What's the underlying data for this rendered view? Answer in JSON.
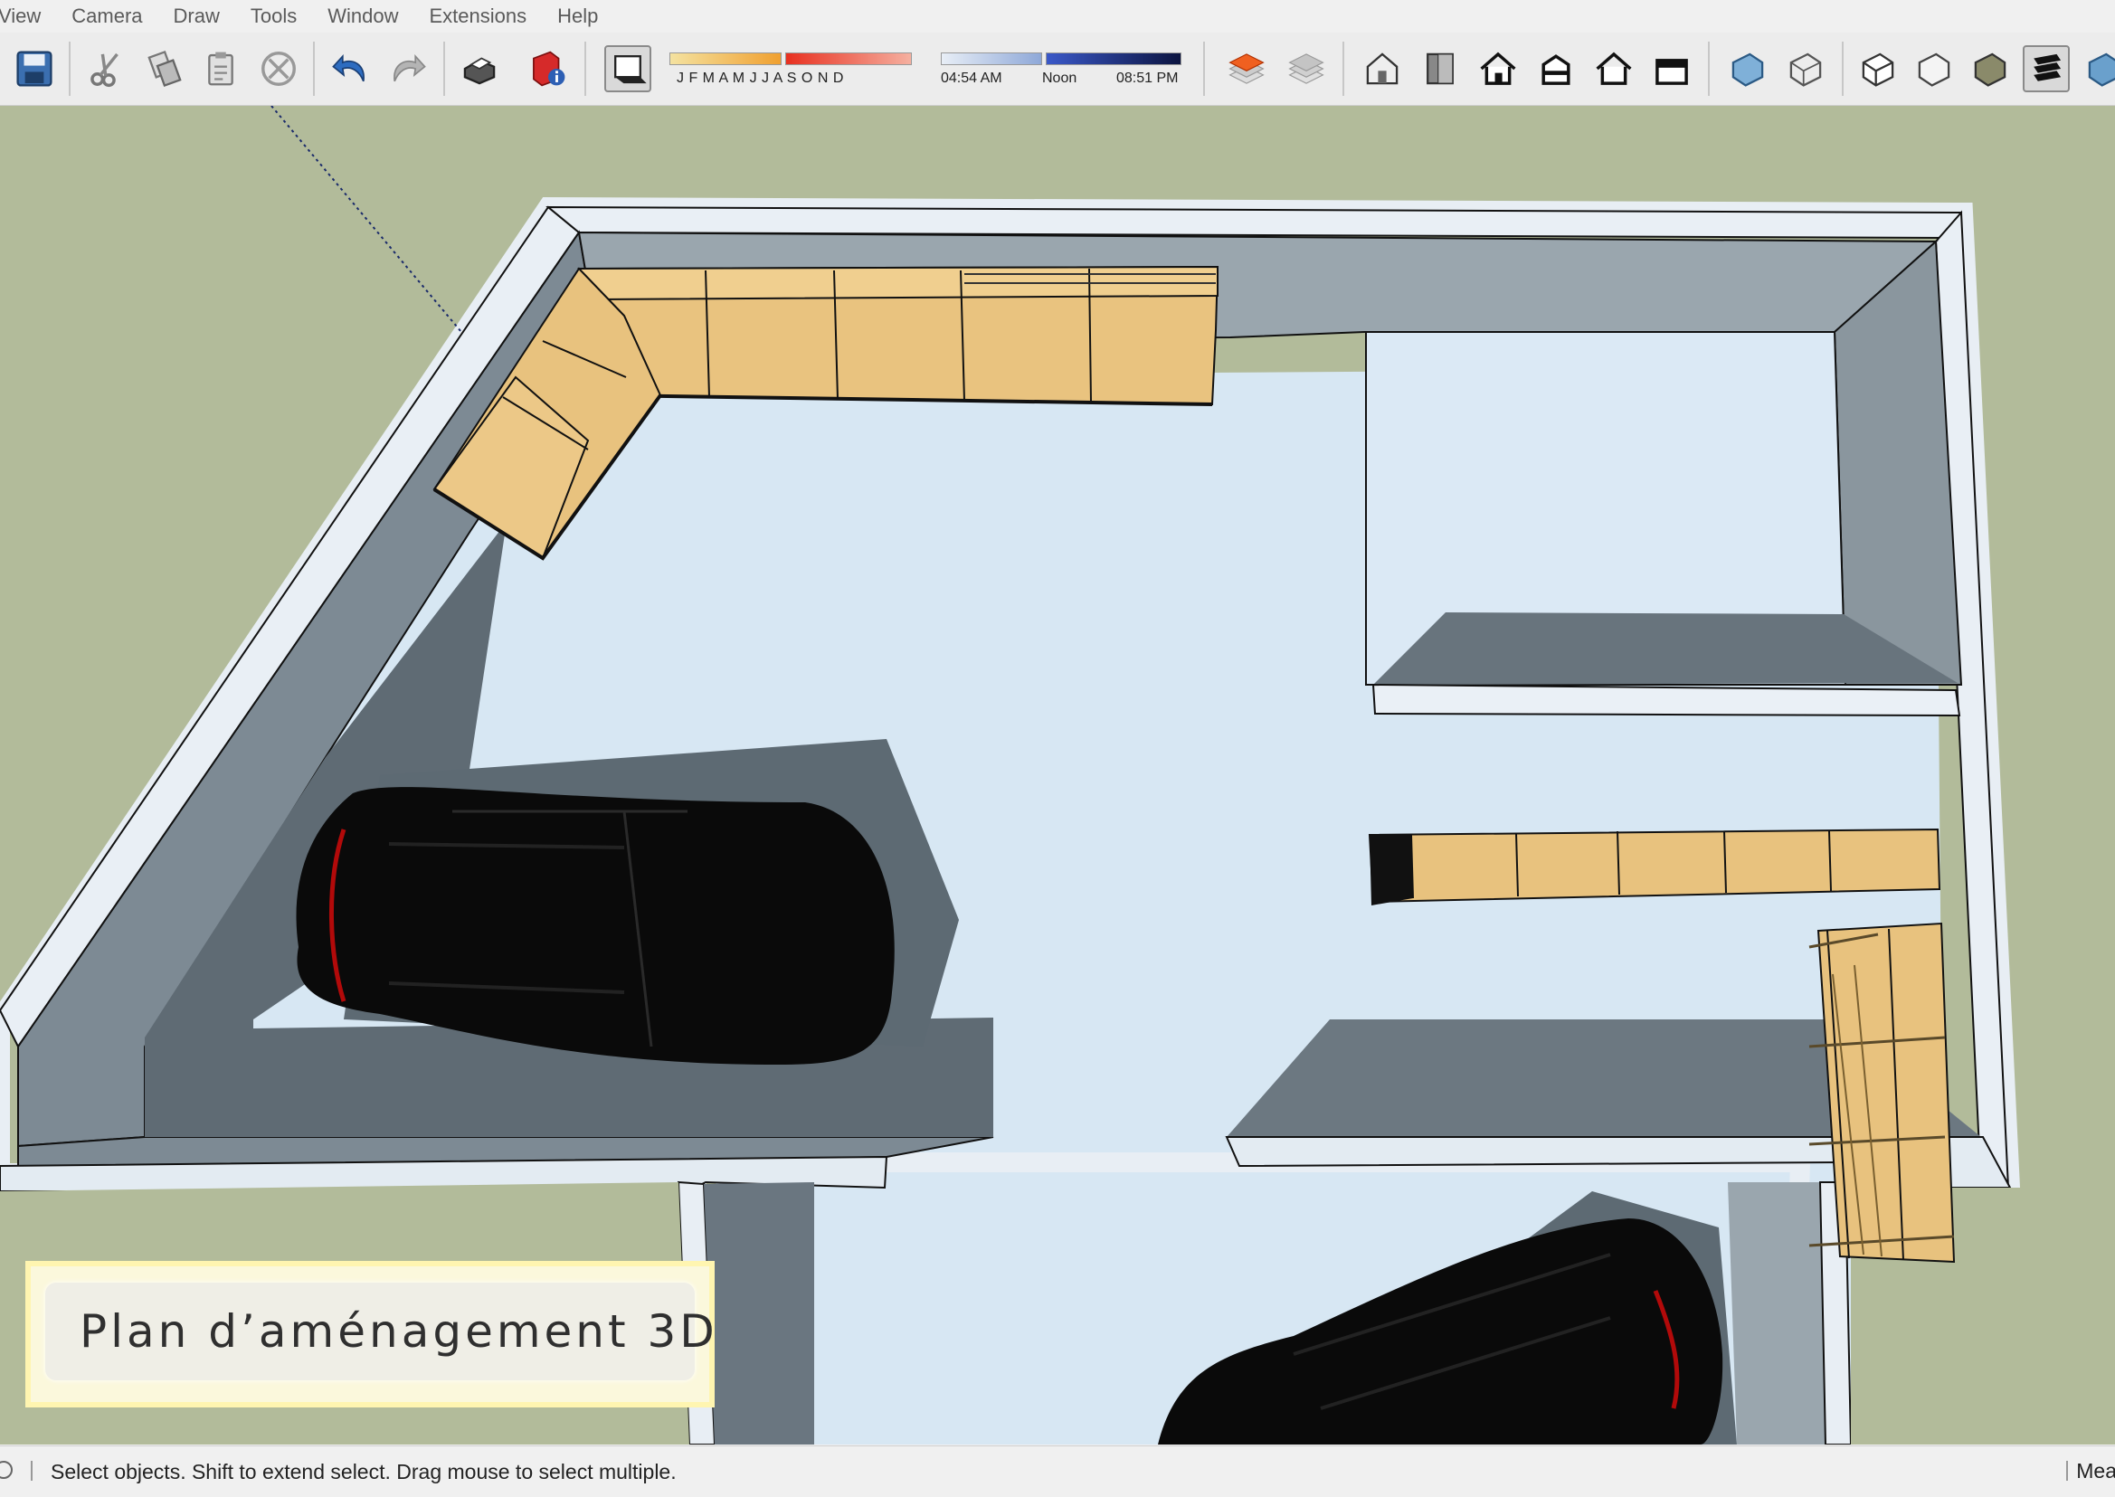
{
  "menu": {
    "items": [
      "View",
      "Camera",
      "Draw",
      "Tools",
      "Window",
      "Extensions",
      "Help"
    ]
  },
  "shadow": {
    "months": "J  F  M  A  M  J  J  A  S  O  N  D",
    "time_start": "04:54 AM",
    "time_mid": "Noon",
    "time_end": "08:51 PM"
  },
  "icons": [
    "save-icon",
    "cut-icon",
    "copy-icon",
    "paste-icon",
    "erase-icon",
    "undo-icon",
    "redo-icon",
    "print-icon",
    "model-info-icon",
    "shadows-toggle-icon",
    "layers-icon",
    "layers-stack-icon",
    "iso-view-icon",
    "front-view-icon",
    "home-view-icon",
    "right-view-icon",
    "back-view-icon",
    "left-view-icon",
    "xray-icon",
    "wireframe-icon",
    "hidden-line-icon",
    "shaded-icon",
    "shaded-textures-icon",
    "monochrome-icon"
  ],
  "overlay": {
    "title": "Plan d’aménagement 3D"
  },
  "status": {
    "text": "Select objects. Shift to extend select. Drag mouse to select multiple.",
    "right": "Mea"
  },
  "colors": {
    "ground": "#b2bb9a",
    "floor": "#d7e7f3",
    "wall_top": "#e8eef4",
    "wall_side": "#7d8a94",
    "shadow": "#5f6b74",
    "cabinet": "#e8c27e",
    "car": "#0a0a0a"
  }
}
